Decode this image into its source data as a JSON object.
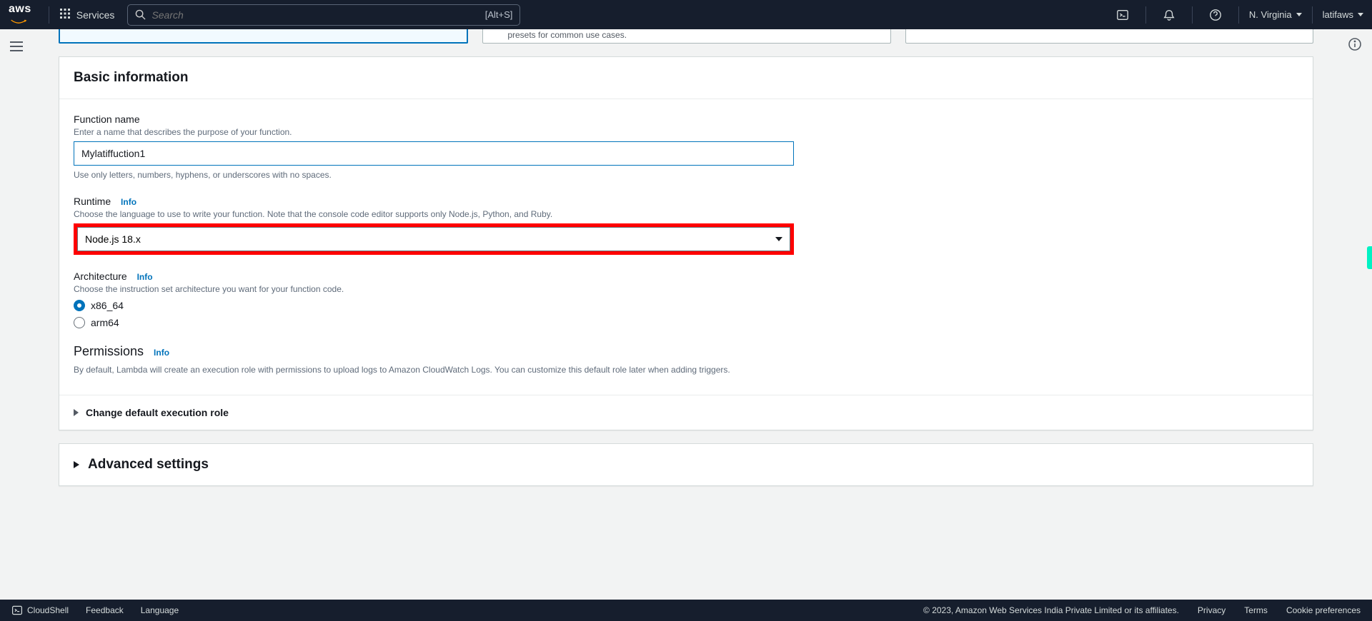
{
  "nav": {
    "logo_text": "aws",
    "services_label": "Services",
    "search_placeholder": "Search",
    "search_hint": "[Alt+S]",
    "region": "N. Virginia",
    "user": "latifaws"
  },
  "option_cards": {
    "card2_desc": "presets for common use cases."
  },
  "basic_info": {
    "panel_title": "Basic information",
    "fn": {
      "label": "Function name",
      "desc": "Enter a name that describes the purpose of your function.",
      "value": "Mylatiffuction1",
      "help": "Use only letters, numbers, hyphens, or underscores with no spaces."
    },
    "runtime": {
      "label": "Runtime",
      "info": "Info",
      "desc": "Choose the language to use to write your function. Note that the console code editor supports only Node.js, Python, and Ruby.",
      "value": "Node.js 18.x"
    },
    "arch": {
      "label": "Architecture",
      "info": "Info",
      "desc": "Choose the instruction set architecture you want for your function code.",
      "option1": "x86_64",
      "option2": "arm64"
    },
    "permissions": {
      "label": "Permissions",
      "info": "Info",
      "desc": "By default, Lambda will create an execution role with permissions to upload logs to Amazon CloudWatch Logs. You can customize this default role later when adding triggers."
    },
    "exec_role_toggle": "Change default execution role"
  },
  "advanced": {
    "title": "Advanced settings"
  },
  "footer": {
    "cloudshell": "CloudShell",
    "feedback": "Feedback",
    "language": "Language",
    "copyright": "© 2023, Amazon Web Services India Private Limited or its affiliates.",
    "privacy": "Privacy",
    "terms": "Terms",
    "cookies": "Cookie preferences"
  }
}
